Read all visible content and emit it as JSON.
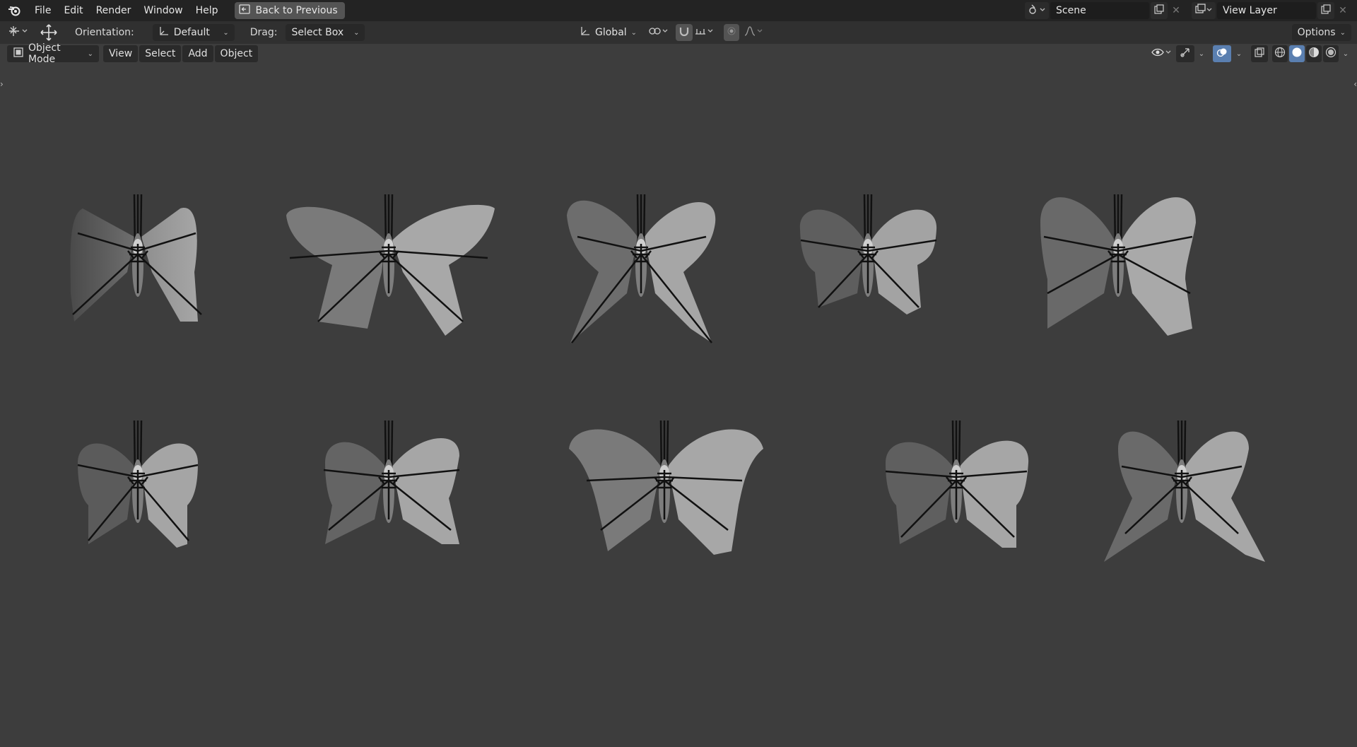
{
  "menubar": {
    "items": [
      "File",
      "Edit",
      "Render",
      "Window",
      "Help"
    ],
    "back_button": "Back to Previous",
    "scene": "Scene",
    "view_layer": "View Layer"
  },
  "toolbar": {
    "orientation_label": "Orientation:",
    "orientation_value": "Default",
    "drag_label": "Drag:",
    "drag_value": "Select Box",
    "transform_space": "Global",
    "options": "Options"
  },
  "viewport_header": {
    "mode": "Object Mode",
    "menus": [
      "View",
      "Select",
      "Add",
      "Object"
    ]
  },
  "colors": {
    "accent": "#5a7fb0",
    "background": "#3d3d3d"
  },
  "viewport": {
    "butterfly_count": 10
  }
}
